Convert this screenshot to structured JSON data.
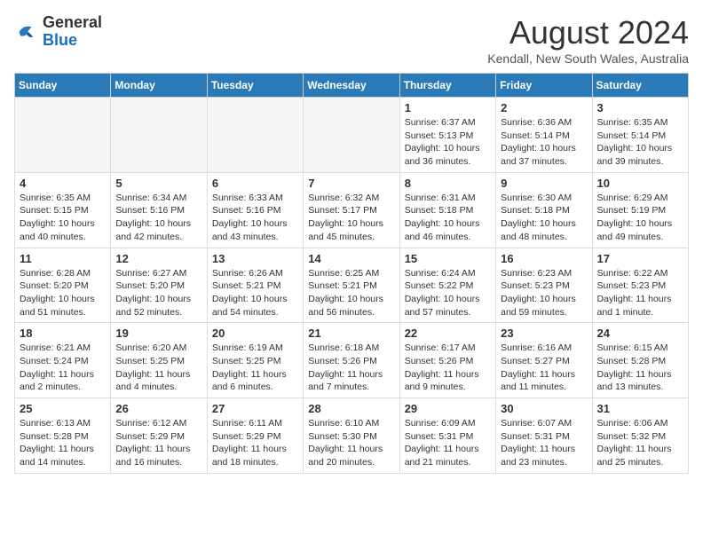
{
  "header": {
    "logo_general": "General",
    "logo_blue": "Blue",
    "month_year": "August 2024",
    "location": "Kendall, New South Wales, Australia"
  },
  "days_of_week": [
    "Sunday",
    "Monday",
    "Tuesday",
    "Wednesday",
    "Thursday",
    "Friday",
    "Saturday"
  ],
  "weeks": [
    [
      {
        "day": "",
        "info": []
      },
      {
        "day": "",
        "info": []
      },
      {
        "day": "",
        "info": []
      },
      {
        "day": "",
        "info": []
      },
      {
        "day": "1",
        "info": [
          "Sunrise: 6:37 AM",
          "Sunset: 5:13 PM",
          "Daylight: 10 hours",
          "and 36 minutes."
        ]
      },
      {
        "day": "2",
        "info": [
          "Sunrise: 6:36 AM",
          "Sunset: 5:14 PM",
          "Daylight: 10 hours",
          "and 37 minutes."
        ]
      },
      {
        "day": "3",
        "info": [
          "Sunrise: 6:35 AM",
          "Sunset: 5:14 PM",
          "Daylight: 10 hours",
          "and 39 minutes."
        ]
      }
    ],
    [
      {
        "day": "4",
        "info": [
          "Sunrise: 6:35 AM",
          "Sunset: 5:15 PM",
          "Daylight: 10 hours",
          "and 40 minutes."
        ]
      },
      {
        "day": "5",
        "info": [
          "Sunrise: 6:34 AM",
          "Sunset: 5:16 PM",
          "Daylight: 10 hours",
          "and 42 minutes."
        ]
      },
      {
        "day": "6",
        "info": [
          "Sunrise: 6:33 AM",
          "Sunset: 5:16 PM",
          "Daylight: 10 hours",
          "and 43 minutes."
        ]
      },
      {
        "day": "7",
        "info": [
          "Sunrise: 6:32 AM",
          "Sunset: 5:17 PM",
          "Daylight: 10 hours",
          "and 45 minutes."
        ]
      },
      {
        "day": "8",
        "info": [
          "Sunrise: 6:31 AM",
          "Sunset: 5:18 PM",
          "Daylight: 10 hours",
          "and 46 minutes."
        ]
      },
      {
        "day": "9",
        "info": [
          "Sunrise: 6:30 AM",
          "Sunset: 5:18 PM",
          "Daylight: 10 hours",
          "and 48 minutes."
        ]
      },
      {
        "day": "10",
        "info": [
          "Sunrise: 6:29 AM",
          "Sunset: 5:19 PM",
          "Daylight: 10 hours",
          "and 49 minutes."
        ]
      }
    ],
    [
      {
        "day": "11",
        "info": [
          "Sunrise: 6:28 AM",
          "Sunset: 5:20 PM",
          "Daylight: 10 hours",
          "and 51 minutes."
        ]
      },
      {
        "day": "12",
        "info": [
          "Sunrise: 6:27 AM",
          "Sunset: 5:20 PM",
          "Daylight: 10 hours",
          "and 52 minutes."
        ]
      },
      {
        "day": "13",
        "info": [
          "Sunrise: 6:26 AM",
          "Sunset: 5:21 PM",
          "Daylight: 10 hours",
          "and 54 minutes."
        ]
      },
      {
        "day": "14",
        "info": [
          "Sunrise: 6:25 AM",
          "Sunset: 5:21 PM",
          "Daylight: 10 hours",
          "and 56 minutes."
        ]
      },
      {
        "day": "15",
        "info": [
          "Sunrise: 6:24 AM",
          "Sunset: 5:22 PM",
          "Daylight: 10 hours",
          "and 57 minutes."
        ]
      },
      {
        "day": "16",
        "info": [
          "Sunrise: 6:23 AM",
          "Sunset: 5:23 PM",
          "Daylight: 10 hours",
          "and 59 minutes."
        ]
      },
      {
        "day": "17",
        "info": [
          "Sunrise: 6:22 AM",
          "Sunset: 5:23 PM",
          "Daylight: 11 hours",
          "and 1 minute."
        ]
      }
    ],
    [
      {
        "day": "18",
        "info": [
          "Sunrise: 6:21 AM",
          "Sunset: 5:24 PM",
          "Daylight: 11 hours",
          "and 2 minutes."
        ]
      },
      {
        "day": "19",
        "info": [
          "Sunrise: 6:20 AM",
          "Sunset: 5:25 PM",
          "Daylight: 11 hours",
          "and 4 minutes."
        ]
      },
      {
        "day": "20",
        "info": [
          "Sunrise: 6:19 AM",
          "Sunset: 5:25 PM",
          "Daylight: 11 hours",
          "and 6 minutes."
        ]
      },
      {
        "day": "21",
        "info": [
          "Sunrise: 6:18 AM",
          "Sunset: 5:26 PM",
          "Daylight: 11 hours",
          "and 7 minutes."
        ]
      },
      {
        "day": "22",
        "info": [
          "Sunrise: 6:17 AM",
          "Sunset: 5:26 PM",
          "Daylight: 11 hours",
          "and 9 minutes."
        ]
      },
      {
        "day": "23",
        "info": [
          "Sunrise: 6:16 AM",
          "Sunset: 5:27 PM",
          "Daylight: 11 hours",
          "and 11 minutes."
        ]
      },
      {
        "day": "24",
        "info": [
          "Sunrise: 6:15 AM",
          "Sunset: 5:28 PM",
          "Daylight: 11 hours",
          "and 13 minutes."
        ]
      }
    ],
    [
      {
        "day": "25",
        "info": [
          "Sunrise: 6:13 AM",
          "Sunset: 5:28 PM",
          "Daylight: 11 hours",
          "and 14 minutes."
        ]
      },
      {
        "day": "26",
        "info": [
          "Sunrise: 6:12 AM",
          "Sunset: 5:29 PM",
          "Daylight: 11 hours",
          "and 16 minutes."
        ]
      },
      {
        "day": "27",
        "info": [
          "Sunrise: 6:11 AM",
          "Sunset: 5:29 PM",
          "Daylight: 11 hours",
          "and 18 minutes."
        ]
      },
      {
        "day": "28",
        "info": [
          "Sunrise: 6:10 AM",
          "Sunset: 5:30 PM",
          "Daylight: 11 hours",
          "and 20 minutes."
        ]
      },
      {
        "day": "29",
        "info": [
          "Sunrise: 6:09 AM",
          "Sunset: 5:31 PM",
          "Daylight: 11 hours",
          "and 21 minutes."
        ]
      },
      {
        "day": "30",
        "info": [
          "Sunrise: 6:07 AM",
          "Sunset: 5:31 PM",
          "Daylight: 11 hours",
          "and 23 minutes."
        ]
      },
      {
        "day": "31",
        "info": [
          "Sunrise: 6:06 AM",
          "Sunset: 5:32 PM",
          "Daylight: 11 hours",
          "and 25 minutes."
        ]
      }
    ]
  ]
}
